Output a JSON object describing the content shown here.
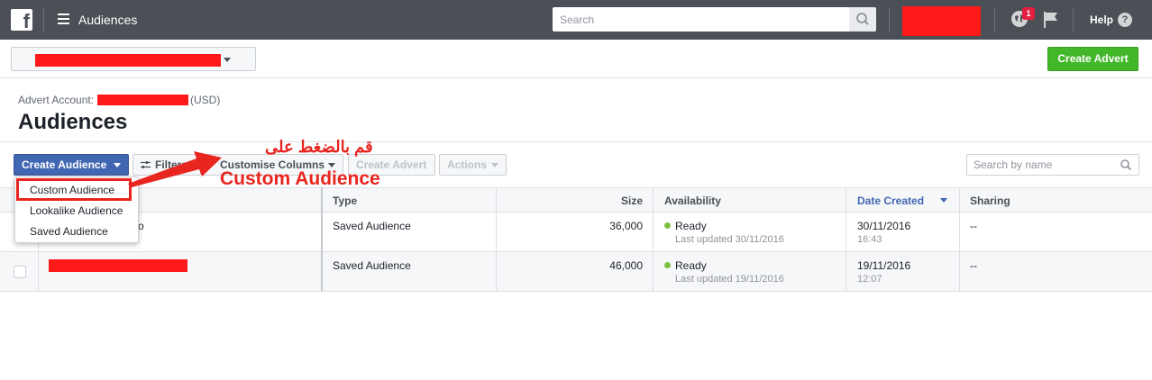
{
  "topbar": {
    "logo_letter": "f",
    "title": "Audiences",
    "search_placeholder": "Search",
    "notification_count": "1",
    "help_label": "Help",
    "help_glyph": "?"
  },
  "subbar": {
    "create_advert_label": "Create Advert"
  },
  "account": {
    "label": "Advert Account:",
    "currency": "(USD)"
  },
  "page_title": "Audiences",
  "toolbar": {
    "create_audience_label": "Create Audience",
    "filters_label": "Filters",
    "customise_columns_label": "Customise Columns",
    "create_advert_label": "Create Advert",
    "actions_label": "Actions",
    "search_placeholder": "Search by name"
  },
  "dropdown": {
    "items": [
      "Custom Audience",
      "Lookalike Audience",
      "Saved Audience"
    ]
  },
  "table": {
    "columns": [
      "Type",
      "Size",
      "Availability",
      "Date Created",
      "Sharing"
    ],
    "rows": [
      {
        "name_fragment": "co",
        "type": "Saved Audience",
        "size": "36,000",
        "availability": "Ready",
        "last_updated": "Last updated 30/11/2016",
        "date": "30/11/2016",
        "time": "16:43",
        "sharing": "--"
      },
      {
        "name_fragment": "",
        "type": "Saved Audience",
        "size": "46,000",
        "availability": "Ready",
        "last_updated": "Last updated 19/11/2016",
        "date": "19/11/2016",
        "time": "12:07",
        "sharing": "--"
      }
    ]
  },
  "annotation": {
    "arabic": "قم بالضغط على",
    "english": "Custom Audience"
  },
  "colors": {
    "topbar": "#4b4f56",
    "primary": "#4267b2",
    "green": "#42b72a",
    "annotation_red": "#e8251f",
    "redaction": "#ff1a1a"
  }
}
